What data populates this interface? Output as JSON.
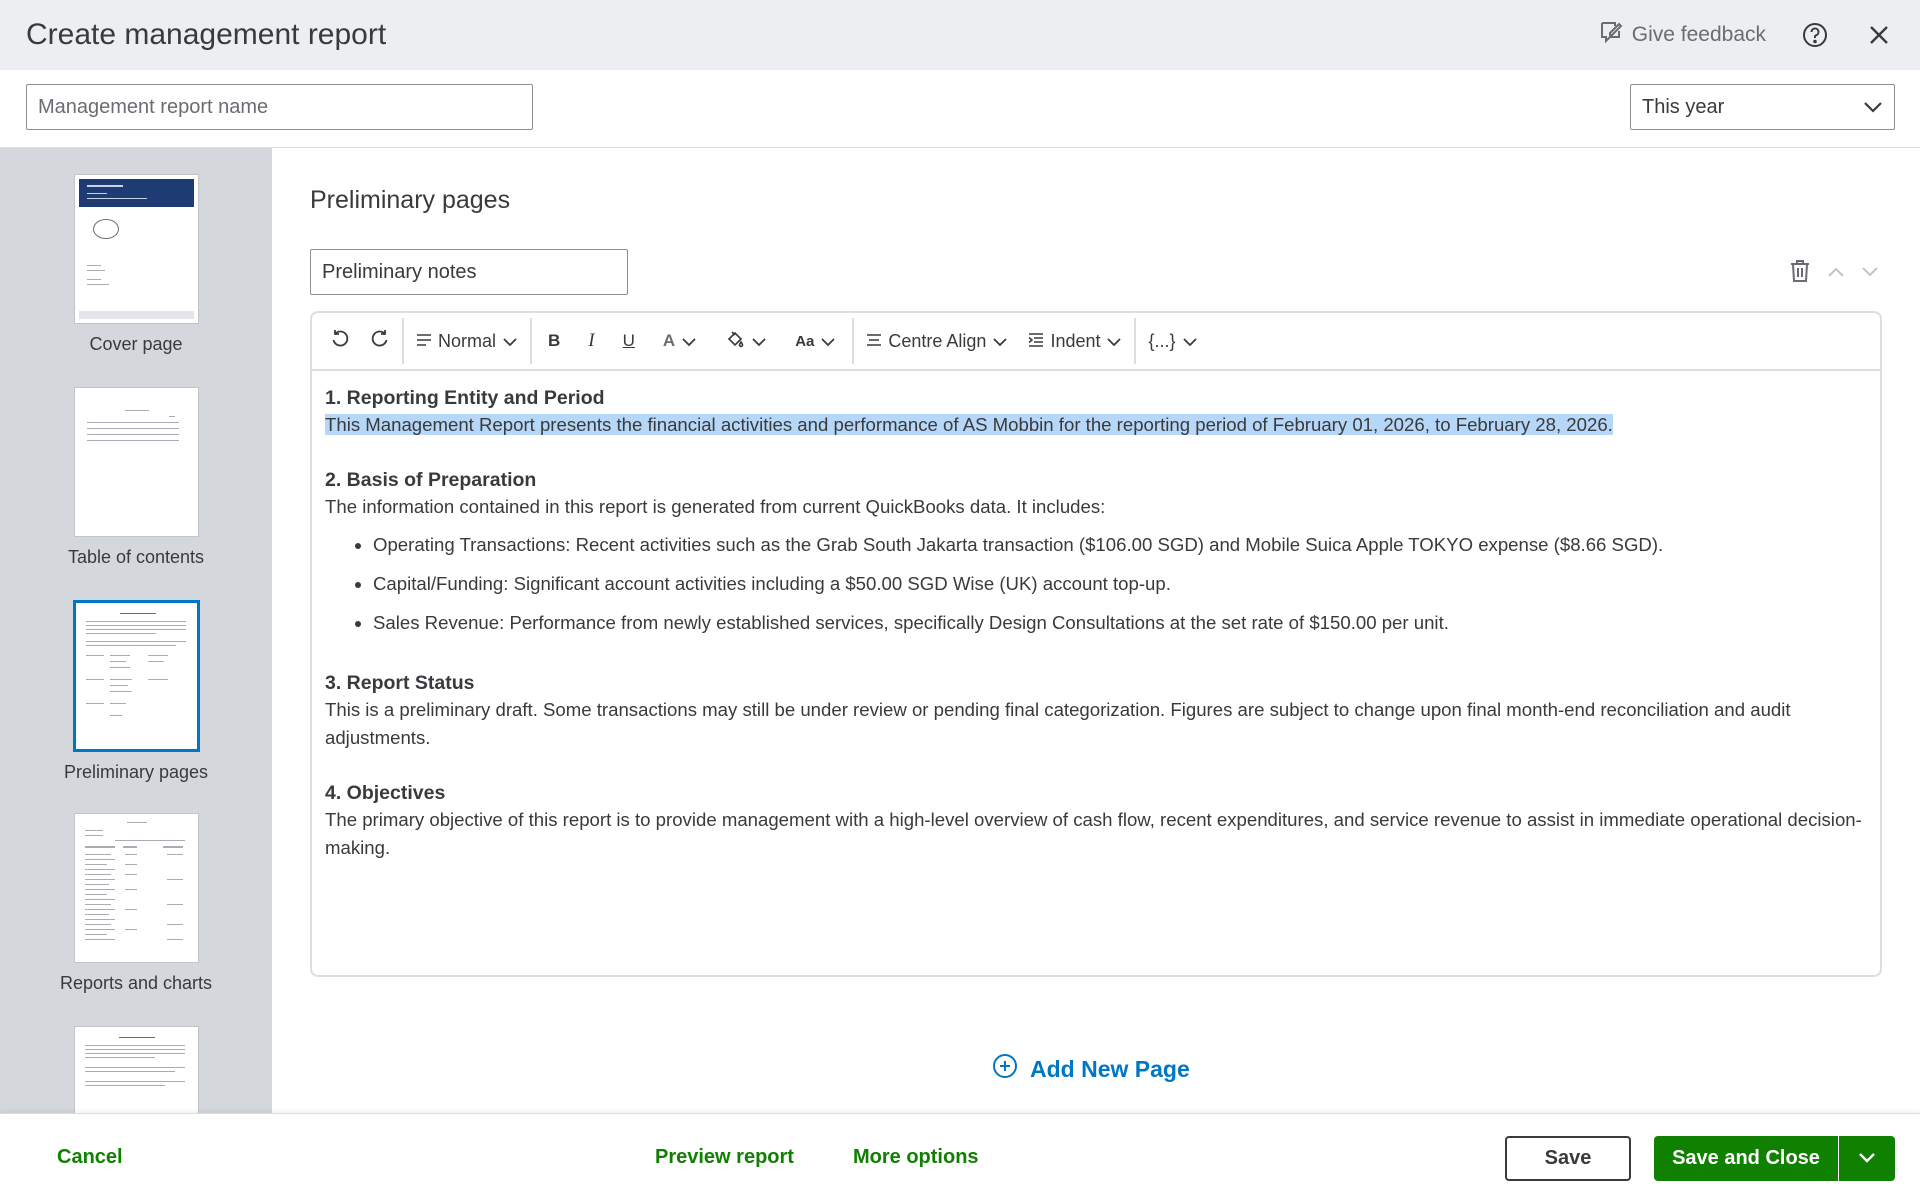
{
  "header": {
    "title": "Create management report",
    "feedback_label": "Give feedback",
    "help_icon": "help-circle-icon",
    "close_icon": "close-icon"
  },
  "report": {
    "name_placeholder": "Management report name",
    "name_value": "",
    "period_value": "This year"
  },
  "sidebar": {
    "items": [
      {
        "label": "Cover page",
        "selected": false
      },
      {
        "label": "Table of contents",
        "selected": false
      },
      {
        "label": "Preliminary pages",
        "selected": true
      },
      {
        "label": "Reports and charts",
        "selected": false
      },
      {
        "label": "",
        "selected": false
      }
    ]
  },
  "main": {
    "section_title": "Preliminary pages",
    "page_name_value": "Preliminary notes",
    "toolbar": {
      "style_label": "Normal",
      "bold_label": "B",
      "italic_label": "I",
      "underline_label": "U",
      "font_color_label": "A",
      "font_size_label": "Aa",
      "align_label": "Centre Align",
      "indent_label": "Indent",
      "variables_label": "{...}"
    },
    "content": {
      "h1": "1. Reporting Entity and Period",
      "p1": "This Management Report presents the financial activities and performance of AS Mobbin for the reporting period of February 01, 2026, to February 28, 2026.",
      "h2": "2. Basis of Preparation",
      "p2": "The information contained in this report is generated from current QuickBooks data. It includes:",
      "bullets": [
        "Operating Transactions: Recent activities such as the Grab South Jakarta transaction ($106.00 SGD) and Mobile Suica Apple TOKYO expense ($8.66 SGD).",
        "Capital/Funding: Significant account activities including a $50.00 SGD Wise (UK) account top-up.",
        "Sales Revenue: Performance from newly established services, specifically Design Consultations at the set rate of $150.00 per unit."
      ],
      "h3": "3. Report Status",
      "p3": "This is a preliminary draft. Some transactions may still be under review or pending final categorization. Figures are subject to change upon final month-end reconciliation and audit adjustments.",
      "h4": "4. Objectives",
      "p4": "The primary objective of this report is to provide management with a high-level overview of cash flow, recent expenditures, and service revenue to assist in immediate operational decision-making."
    },
    "add_page_label": "Add New Page"
  },
  "footer": {
    "cancel_label": "Cancel",
    "preview_label": "Preview report",
    "more_options_label": "More options",
    "save_label": "Save",
    "save_close_label": "Save and Close"
  },
  "colors": {
    "primary_green": "#108000",
    "link_blue": "#0077c5",
    "highlight": "#b6d7f7",
    "sidebar_bg": "#d4d7dc",
    "header_bg": "#eceef1"
  }
}
